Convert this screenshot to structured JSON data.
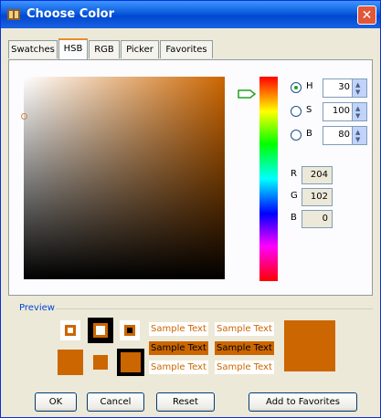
{
  "window": {
    "title": "Choose Color",
    "close_glyph": "✕"
  },
  "tabs": [
    {
      "label": "Swatches",
      "active": false
    },
    {
      "label": "HSB",
      "active": true
    },
    {
      "label": "RGB",
      "active": false
    },
    {
      "label": "Picker",
      "active": false
    },
    {
      "label": "Favorites",
      "active": false
    }
  ],
  "hsb": {
    "h": {
      "label": "H",
      "value": "30",
      "selected": true
    },
    "s": {
      "label": "S",
      "value": "100",
      "selected": false
    },
    "b": {
      "label": "B",
      "value": "80",
      "selected": false
    }
  },
  "rgb": {
    "r": {
      "label": "R",
      "value": "204"
    },
    "g": {
      "label": "G",
      "value": "102"
    },
    "b": {
      "label": "B",
      "value": "0"
    }
  },
  "preview": {
    "label": "Preview",
    "sample_text": "Sample Text",
    "color": "#cc6600"
  },
  "buttons": {
    "ok": "OK",
    "cancel": "Cancel",
    "reset": "Reset",
    "add_favorites": "Add to Favorites"
  },
  "icons": {
    "spin_up": "▲",
    "spin_down": "▼"
  }
}
